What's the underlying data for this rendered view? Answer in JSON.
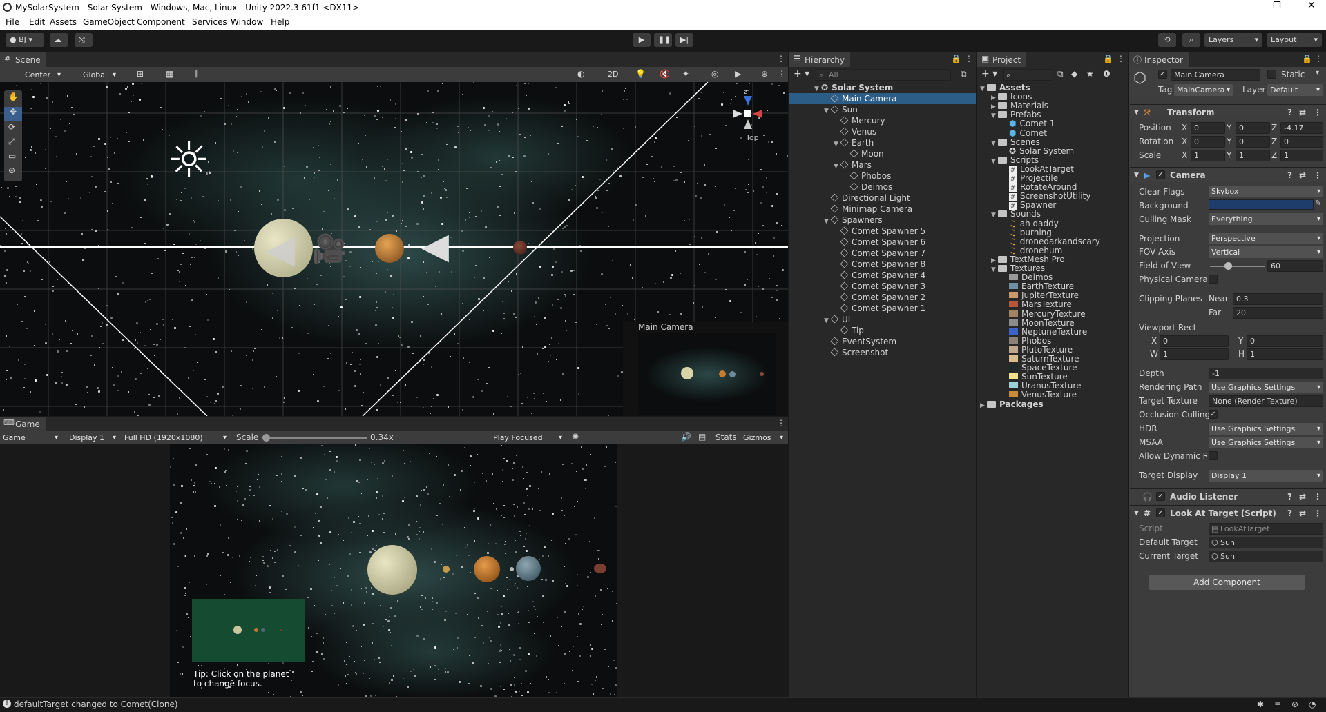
{
  "window": {
    "title": "MySolarSystem - Solar System - Windows, Mac, Linux - Unity 2022.3.61f1 <DX11>"
  },
  "menu": [
    "File",
    "Edit",
    "Assets",
    "GameObject",
    "Component",
    "Services",
    "Window",
    "Help"
  ],
  "toolbar": {
    "account": "BJ",
    "layers": "Layers",
    "layout": "Layout"
  },
  "scene": {
    "tab": "Scene",
    "pivot": "Center",
    "space": "Global",
    "mode2d": "2D",
    "view": "Top",
    "cam_overlay": "Main Camera"
  },
  "game": {
    "tab": "Game",
    "mode": "Game",
    "display": "Display 1",
    "resolution": "Full HD (1920x1080)",
    "scale_label": "Scale",
    "scale_value": "0.34x",
    "play": "Play Focused",
    "stats": "Stats",
    "gizmos": "Gizmos",
    "tip": "Tip: Click on the planet to change focus."
  },
  "hierarchy": {
    "tab": "Hierarchy",
    "search": "All",
    "items": [
      {
        "label": "Solar System",
        "depth": 0,
        "exp": "▼",
        "kind": "scene"
      },
      {
        "label": "Main Camera",
        "depth": 1,
        "exp": "",
        "kind": "go",
        "selected": true
      },
      {
        "label": "Sun",
        "depth": 1,
        "exp": "▼",
        "kind": "go"
      },
      {
        "label": "Mercury",
        "depth": 2,
        "exp": "",
        "kind": "go"
      },
      {
        "label": "Venus",
        "depth": 2,
        "exp": "",
        "kind": "go"
      },
      {
        "label": "Earth",
        "depth": 2,
        "exp": "▼",
        "kind": "go"
      },
      {
        "label": "Moon",
        "depth": 3,
        "exp": "",
        "kind": "go"
      },
      {
        "label": "Mars",
        "depth": 2,
        "exp": "▼",
        "kind": "go"
      },
      {
        "label": "Phobos",
        "depth": 3,
        "exp": "",
        "kind": "go"
      },
      {
        "label": "Deimos",
        "depth": 3,
        "exp": "",
        "kind": "go"
      },
      {
        "label": "Directional Light",
        "depth": 1,
        "exp": "",
        "kind": "go"
      },
      {
        "label": "Minimap Camera",
        "depth": 1,
        "exp": "",
        "kind": "go"
      },
      {
        "label": "Spawners",
        "depth": 1,
        "exp": "▼",
        "kind": "go"
      },
      {
        "label": "Comet Spawner 5",
        "depth": 2,
        "exp": "",
        "kind": "go"
      },
      {
        "label": "Comet Spawner 6",
        "depth": 2,
        "exp": "",
        "kind": "go"
      },
      {
        "label": "Comet Spawner 7",
        "depth": 2,
        "exp": "",
        "kind": "go"
      },
      {
        "label": "Comet Spawner 8",
        "depth": 2,
        "exp": "",
        "kind": "go"
      },
      {
        "label": "Comet Spawner 4",
        "depth": 2,
        "exp": "",
        "kind": "go"
      },
      {
        "label": "Comet Spawner 3",
        "depth": 2,
        "exp": "",
        "kind": "go"
      },
      {
        "label": "Comet Spawner 2",
        "depth": 2,
        "exp": "",
        "kind": "go"
      },
      {
        "label": "Comet Spawner 1",
        "depth": 2,
        "exp": "",
        "kind": "go"
      },
      {
        "label": "UI",
        "depth": 1,
        "exp": "▼",
        "kind": "go"
      },
      {
        "label": "Tip",
        "depth": 2,
        "exp": "",
        "kind": "go"
      },
      {
        "label": "EventSystem",
        "depth": 1,
        "exp": "",
        "kind": "go"
      },
      {
        "label": "Screenshot",
        "depth": 1,
        "exp": "",
        "kind": "go"
      }
    ]
  },
  "project": {
    "tab": "Project",
    "items": [
      {
        "label": "Assets",
        "depth": 0,
        "exp": "▼",
        "kind": "folder",
        "bold": true
      },
      {
        "label": "Icons",
        "depth": 1,
        "exp": "▶",
        "kind": "folder"
      },
      {
        "label": "Materials",
        "depth": 1,
        "exp": "▶",
        "kind": "folder"
      },
      {
        "label": "Prefabs",
        "depth": 1,
        "exp": "▼",
        "kind": "folder"
      },
      {
        "label": "Comet 1",
        "depth": 2,
        "exp": "",
        "kind": "prefab"
      },
      {
        "label": "Comet",
        "depth": 2,
        "exp": "",
        "kind": "prefab"
      },
      {
        "label": "Scenes",
        "depth": 1,
        "exp": "▼",
        "kind": "folder"
      },
      {
        "label": "Solar System",
        "depth": 2,
        "exp": "",
        "kind": "scene"
      },
      {
        "label": "Scripts",
        "depth": 1,
        "exp": "▼",
        "kind": "folder"
      },
      {
        "label": "LookAtTarget",
        "depth": 2,
        "exp": "",
        "kind": "script"
      },
      {
        "label": "Projectile",
        "depth": 2,
        "exp": "",
        "kind": "script"
      },
      {
        "label": "RotateAround",
        "depth": 2,
        "exp": "",
        "kind": "script"
      },
      {
        "label": "ScreenshotUtility",
        "depth": 2,
        "exp": "",
        "kind": "script"
      },
      {
        "label": "Spawner",
        "depth": 2,
        "exp": "",
        "kind": "script"
      },
      {
        "label": "Sounds",
        "depth": 1,
        "exp": "▼",
        "kind": "folder"
      },
      {
        "label": "ah daddy",
        "depth": 2,
        "exp": "",
        "kind": "sound"
      },
      {
        "label": "burning",
        "depth": 2,
        "exp": "",
        "kind": "sound"
      },
      {
        "label": "dronedarkandscary",
        "depth": 2,
        "exp": "",
        "kind": "sound"
      },
      {
        "label": "dronehum",
        "depth": 2,
        "exp": "",
        "kind": "sound"
      },
      {
        "label": "TextMesh Pro",
        "depth": 1,
        "exp": "▶",
        "kind": "folder"
      },
      {
        "label": "Textures",
        "depth": 1,
        "exp": "▼",
        "kind": "folder"
      },
      {
        "label": "Deimos",
        "depth": 2,
        "exp": "",
        "kind": "tex",
        "color": "#9a9a9a"
      },
      {
        "label": "EarthTexture",
        "depth": 2,
        "exp": "",
        "kind": "tex",
        "color": "#6f8fa3"
      },
      {
        "label": "JupiterTexture",
        "depth": 2,
        "exp": "",
        "kind": "tex",
        "color": "#c79a6b"
      },
      {
        "label": "MarsTexture",
        "depth": 2,
        "exp": "",
        "kind": "tex",
        "color": "#b5573a"
      },
      {
        "label": "MercuryTexture",
        "depth": 2,
        "exp": "",
        "kind": "tex",
        "color": "#a18463"
      },
      {
        "label": "MoonTexture",
        "depth": 2,
        "exp": "",
        "kind": "tex",
        "color": "#8c8c8c"
      },
      {
        "label": "NeptuneTexture",
        "depth": 2,
        "exp": "",
        "kind": "tex",
        "color": "#3d63c9"
      },
      {
        "label": "Phobos",
        "depth": 2,
        "exp": "",
        "kind": "tex",
        "color": "#8a8179"
      },
      {
        "label": "PlutoTexture",
        "depth": 2,
        "exp": "",
        "kind": "tex",
        "color": "#bfa88e"
      },
      {
        "label": "SaturnTexture",
        "depth": 2,
        "exp": "",
        "kind": "tex",
        "color": "#d9bd8c"
      },
      {
        "label": "SpaceTexture",
        "depth": 2,
        "exp": "",
        "kind": "tex",
        "color": "#1d2a2a"
      },
      {
        "label": "SunTexture",
        "depth": 2,
        "exp": "",
        "kind": "tex",
        "color": "#f2e08a"
      },
      {
        "label": "UranusTexture",
        "depth": 2,
        "exp": "",
        "kind": "tex",
        "color": "#9ad0d6"
      },
      {
        "label": "VenusTexture",
        "depth": 2,
        "exp": "",
        "kind": "tex",
        "color": "#c98a3a"
      },
      {
        "label": "Packages",
        "depth": 0,
        "exp": "▶",
        "kind": "folder",
        "bold": true
      }
    ]
  },
  "inspector": {
    "tab": "Inspector",
    "object": {
      "name": "Main Camera",
      "static": "Static",
      "tag_label": "Tag",
      "tag": "MainCamera",
      "layer_label": "Layer",
      "layer": "Default"
    },
    "transform": {
      "title": "Transform",
      "rows": [
        {
          "label": "Position",
          "x": "0",
          "y": "0",
          "z": "-4.17"
        },
        {
          "label": "Rotation",
          "x": "0",
          "y": "0",
          "z": "0"
        },
        {
          "label": "Scale",
          "x": "1",
          "y": "1",
          "z": "1"
        }
      ]
    },
    "camera": {
      "title": "Camera",
      "clear_flags_label": "Clear Flags",
      "clear_flags": "Skybox",
      "background_label": "Background",
      "background_color": "#1e3d6b",
      "culling_label": "Culling Mask",
      "culling": "Everything",
      "projection_label": "Projection",
      "projection": "Perspective",
      "fov_axis_label": "FOV Axis",
      "fov_axis": "Vertical",
      "fov_label": "Field of View",
      "fov": "60",
      "fov_fraction": 0.33,
      "physical_label": "Physical Camera",
      "clip_label": "Clipping Planes",
      "near_label": "Near",
      "near": "0.3",
      "far_label": "Far",
      "far": "20",
      "viewport_label": "Viewport Rect",
      "vx": "0",
      "vy": "0",
      "vw": "1",
      "vh": "1",
      "depth_label": "Depth",
      "depth": "-1",
      "render_path_label": "Rendering Path",
      "render_path": "Use Graphics Settings",
      "target_tex_label": "Target Texture",
      "target_tex": "None (Render Texture)",
      "occlusion_label": "Occlusion Culling",
      "hdr_label": "HDR",
      "hdr": "Use Graphics Settings",
      "msaa_label": "MSAA",
      "msaa": "Use Graphics Settings",
      "dyn_res_label": "Allow Dynamic Resol",
      "target_display_label": "Target Display",
      "target_display": "Display 1"
    },
    "audio": {
      "title": "Audio Listener"
    },
    "look": {
      "title": "Look At Target (Script)",
      "script_label": "Script",
      "script": "LookAtTarget",
      "default_label": "Default Target",
      "default": "Sun",
      "current_label": "Current Target",
      "current": "Sun"
    },
    "add_component": "Add Component"
  },
  "status": {
    "message": "defaultTarget changed to Comet(Clone)"
  }
}
